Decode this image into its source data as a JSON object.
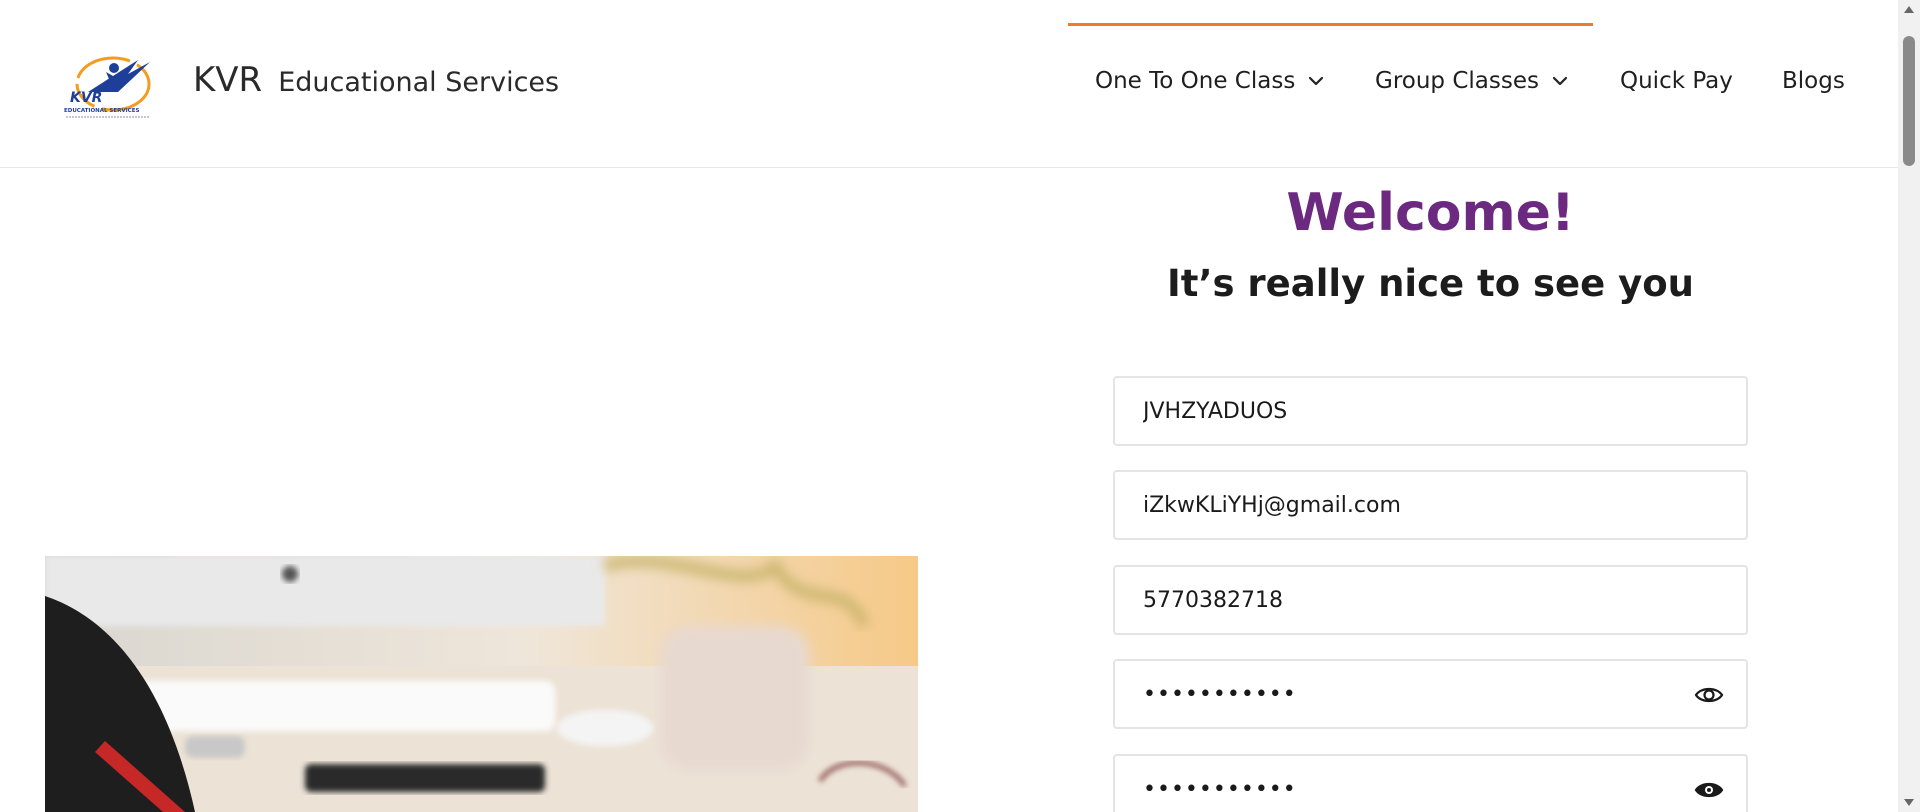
{
  "brand": {
    "name": "KVR",
    "subtitle": "Educational Services",
    "logo_text": "KVR",
    "logo_subtext": "EDUCATIONAL SERVICES"
  },
  "nav": {
    "items": [
      {
        "label": "One To One Class",
        "has_dropdown": true
      },
      {
        "label": "Group Classes",
        "has_dropdown": true
      },
      {
        "label": "Quick Pay",
        "has_dropdown": false
      },
      {
        "label": "Blogs",
        "has_dropdown": false
      }
    ]
  },
  "form": {
    "welcome": "Welcome!",
    "subheading": "It’s really nice to see you",
    "name_value": "JVHZYADUOS",
    "email_value": "iZkwKLiYHj@gmail.com",
    "phone_value": "5770382718",
    "password_value": "•••••••••••",
    "confirm_password_value": "•••••••••••"
  },
  "colors": {
    "accent": "#ef7a2e",
    "welcome": "#6b2a7f",
    "logo_blue": "#1e3f99",
    "logo_orange": "#f39c1f"
  },
  "icons": [
    "chevron-down-icon",
    "eye-icon",
    "eye-icon"
  ]
}
